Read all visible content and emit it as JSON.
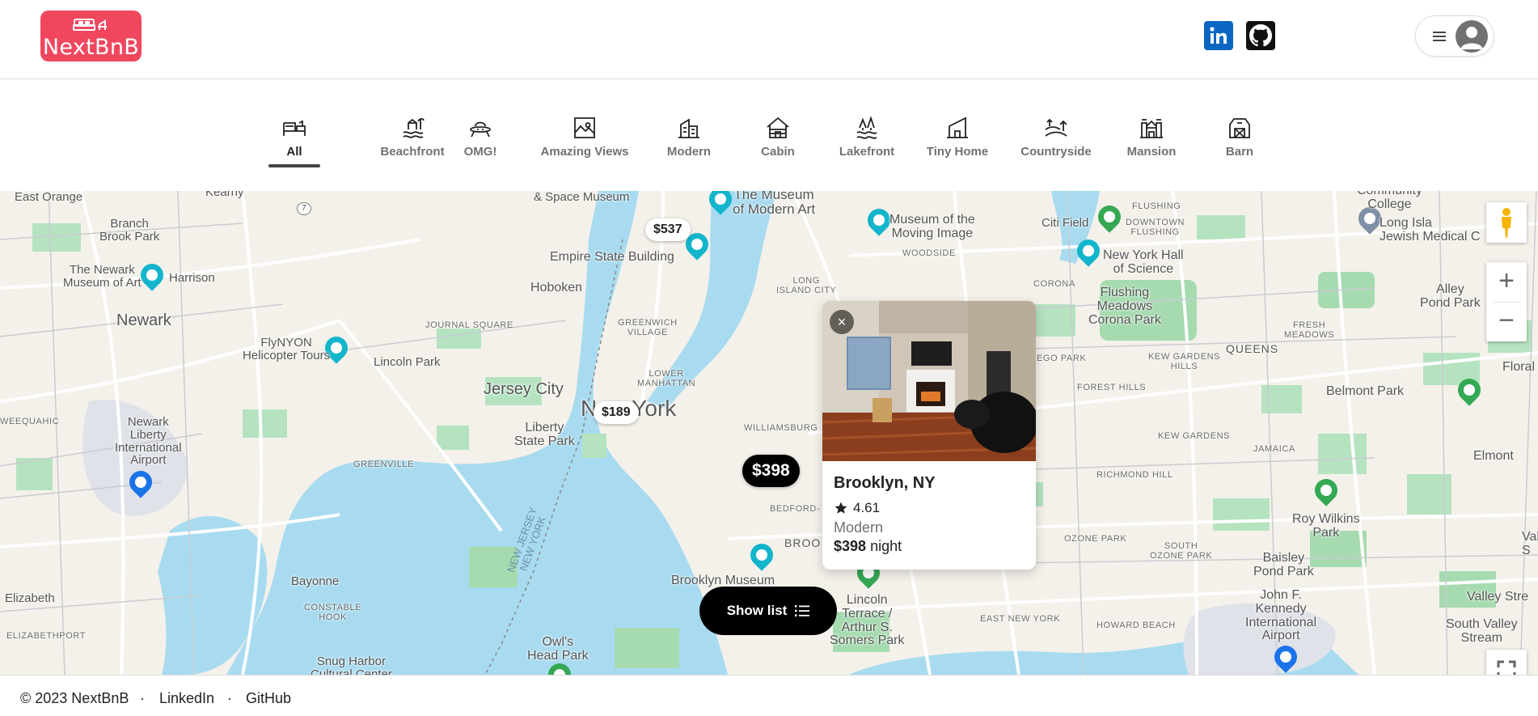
{
  "app": {
    "logo_text": "NextBnB",
    "social": {
      "linkedin_label": "in"
    }
  },
  "categories": [
    {
      "label": "All",
      "icon": "bed-icon",
      "active": true
    },
    {
      "label": "Beachfront",
      "icon": "beach-icon"
    },
    {
      "label": "OMG!",
      "icon": "ufo-icon"
    },
    {
      "label": "Amazing Views",
      "icon": "mountain-view-icon"
    },
    {
      "label": "Modern",
      "icon": "building-icon"
    },
    {
      "label": "Cabin",
      "icon": "cabin-icon"
    },
    {
      "label": "Lakefront",
      "icon": "lake-icon"
    },
    {
      "label": "Tiny Home",
      "icon": "tiny-home-icon"
    },
    {
      "label": "Countryside",
      "icon": "countryside-icon"
    },
    {
      "label": "Mansion",
      "icon": "mansion-icon"
    },
    {
      "label": "Barn",
      "icon": "barn-icon"
    }
  ],
  "map": {
    "labels": {
      "east_orange": "East Orange",
      "kearny": "Kearny",
      "branch_brook": "Branch\nBrook Park",
      "newark_museum": "The Newark\nMuseum of Art",
      "harrison": "Harrison",
      "newark": "Newark",
      "flynyon": "FlyNYON\nHelicopter Tours",
      "lincoln_park": "Lincoln Park",
      "weequahic": "WEEQUAHIC",
      "ewr": "Newark\nLiberty\nInternational\nAirport",
      "elizabeth": "Elizabeth",
      "elizabethport": "ELIZABETHPORT",
      "bayonne": "Bayonne",
      "constable_hook": "CONSTABLE\nHOOK",
      "snug_harbor": "Snug Harbor\nCultural Center",
      "intrepid": "Intrepid Sea, Air\n& Space Museum",
      "moma": "The Museum\nof Modern Art",
      "esb": "Empire State Building",
      "hoboken": "Hoboken",
      "journal_square": "JOURNAL SQUARE",
      "greenwich": "GREENWICH\nVILLAGE",
      "jersey_city": "Jersey City",
      "lower_manhattan": "LOWER\nMANHATTAN",
      "new_york": "New York",
      "liberty_sp": "Liberty\nState Park",
      "greenville": "GREENVILLE",
      "williamsburg": "WILLIAMSBURG",
      "lic": "LONG\nISLAND CITY",
      "moving_image": "Museum of the\nMoving Image",
      "woodside": "WOODSIDE",
      "citi_field": "Citi Field",
      "flushing": "FLUSHING",
      "downtown_flushing": "DOWNTOWN\nFLUSHING",
      "ny_hall_science": "New York Hall\nof Science",
      "corona": "CORONA",
      "flushing_meadows": "Flushing\nMeadows\nCorona Park",
      "community_college": "Community\nCollege",
      "long_island_jewish": "Long Isla\nJewish Medical C",
      "alley_pond": "Alley\nPond Park",
      "fresh_meadows": "FRESH\nMEADOWS",
      "queens": "QUEENS",
      "ego_park": "EGO PARK",
      "kew_gardens_hills": "KEW GARDENS\nHILLS",
      "forest_hills": "FOREST HILLS",
      "floral": "Floral F",
      "belmont": "Belmont Park",
      "kew_gardens": "KEW GARDENS",
      "jamaica": "JAMAICA",
      "richmond_hill": "RICHMOND HILL",
      "elmont": "Elmont",
      "bedford": "BEDFORD-",
      "brooklyn_cut": "BROO",
      "brooklyn_museum": "Brooklyn Museum",
      "lincoln_terrace": "Lincoln\nTerrace /\nArthur S.\nSomers Park",
      "ozone_park": "OZONE PARK",
      "south_ozone": "SOUTH\nOZONE PARK",
      "roy_wilkins": "Roy Wilkins\nPark",
      "baisley": "Baisley\nPond Park",
      "jfk": "John F.\nKennedy\nInternational\nAirport",
      "valley_stream": "Valley Stre",
      "south_valley": "South Valley\nStream",
      "vallu": "Vall\nS",
      "east_ny": "EAST NEW YORK",
      "howard_beach": "HOWARD BEACH",
      "owls_head": "Owl's\nHead Park",
      "nj_ny": "NEW JERSEY\nNEW YORK",
      "route7": "7"
    },
    "price_pins": [
      {
        "label": "$537"
      },
      {
        "label": "$189"
      },
      {
        "label": "$398",
        "active": true
      }
    ],
    "controls": {
      "zoom_in": "+",
      "zoom_out": "−"
    }
  },
  "listing_card": {
    "close": "×",
    "location": "Brooklyn, NY",
    "rating": "4.61",
    "category": "Modern",
    "price": "$398",
    "price_unit": "night"
  },
  "show_list": {
    "label": "Show list"
  },
  "footer": {
    "copyright": "© 2023 NextBnB",
    "separator": "·",
    "linkedin": "LinkedIn",
    "github": "GitHub"
  },
  "colors": {
    "brand": "#f0475f",
    "water": "#a8dbf0",
    "park": "#a6dbb0",
    "land": "#f4f1ea"
  }
}
